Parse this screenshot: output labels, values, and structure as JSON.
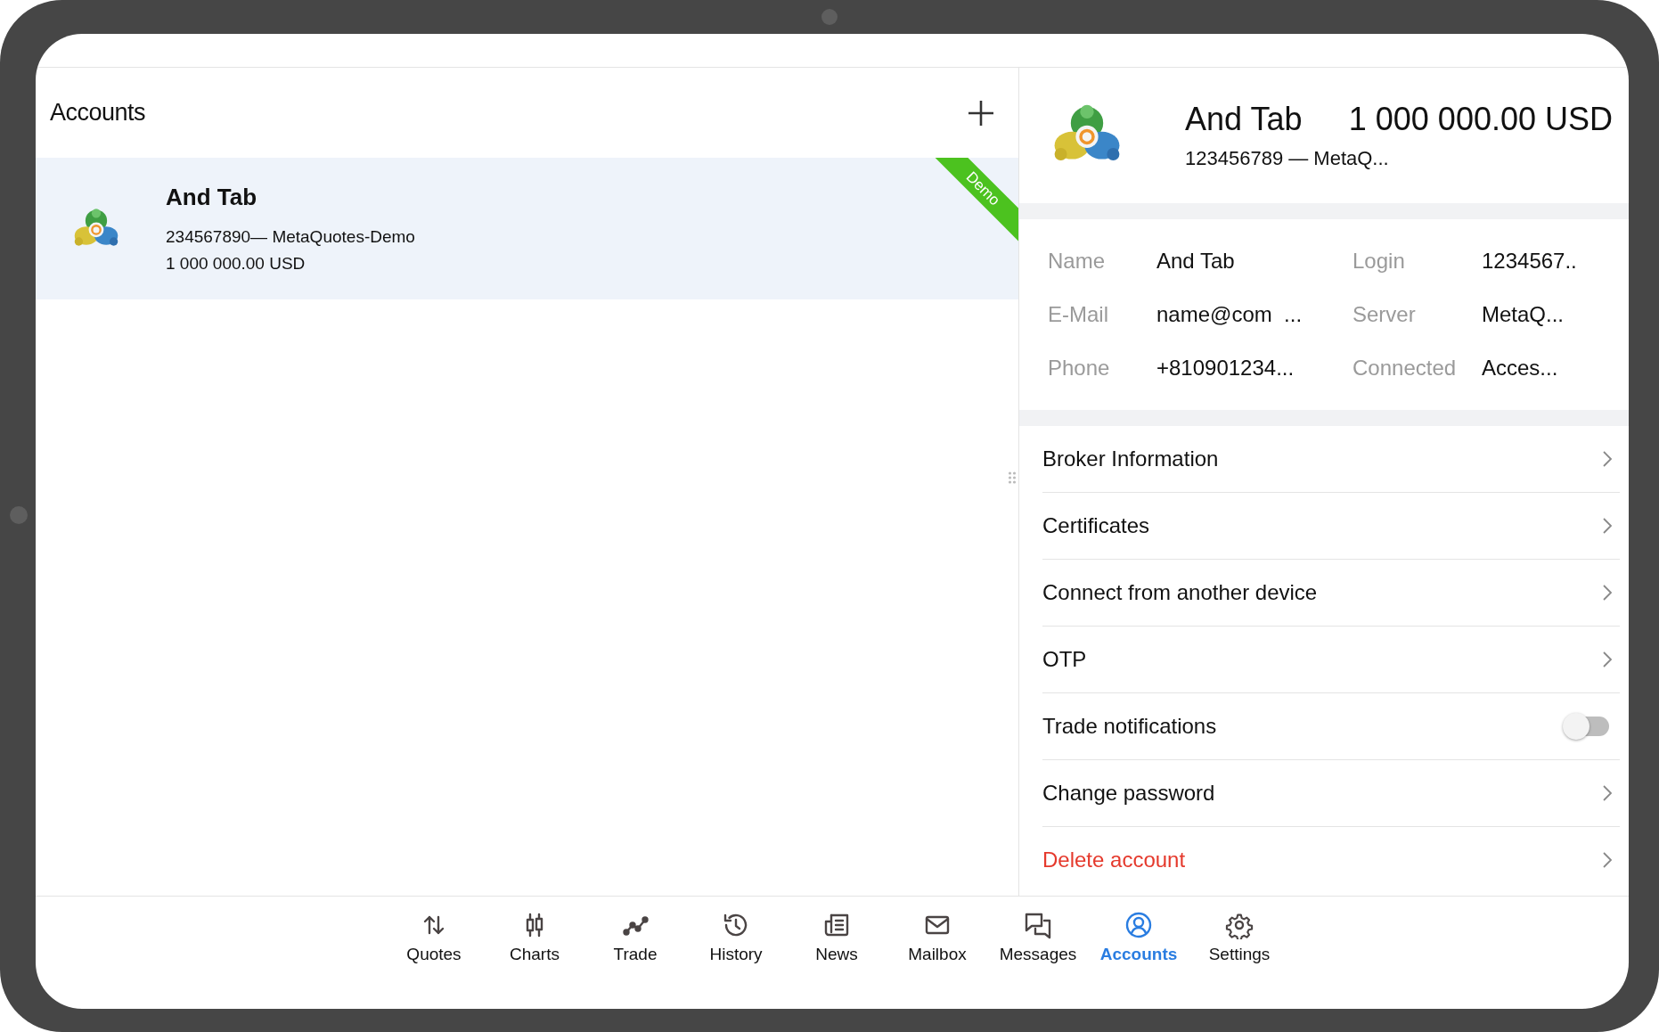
{
  "accounts_panel": {
    "title": "Accounts",
    "accounts": [
      {
        "name": "And Tab",
        "details": "234567890— MetaQuotes-Demo",
        "balance": "1 000 000.00 USD",
        "badge": "Demo",
        "selected": true
      }
    ]
  },
  "account_header": {
    "name": "And Tab",
    "number": "123456789 — MetaQ...",
    "balance": "1 000 000.00 USD"
  },
  "info": [
    {
      "label": "Name",
      "value": "And Tab"
    },
    {
      "label": "Login",
      "value": "1234567.."
    },
    {
      "label": "E-Mail",
      "value": "name@com  ..."
    },
    {
      "label": "Server",
      "value": "MetaQ..."
    },
    {
      "label": "Phone",
      "value": "+810901234..."
    },
    {
      "label": "Connected",
      "value": "Acces..."
    }
  ],
  "menu": [
    {
      "label": "Broker Information",
      "kind": "link"
    },
    {
      "label": "Certificates",
      "kind": "link"
    },
    {
      "label": "Connect from another device",
      "kind": "link"
    },
    {
      "label": "OTP",
      "kind": "link"
    },
    {
      "label": "Trade notifications",
      "kind": "toggle",
      "on": false
    },
    {
      "label": "Change password",
      "kind": "link"
    },
    {
      "label": "Delete account",
      "kind": "danger"
    }
  ],
  "nav": [
    {
      "label": "Quotes",
      "selected": false
    },
    {
      "label": "Charts",
      "selected": false
    },
    {
      "label": "Trade",
      "selected": false
    },
    {
      "label": "History",
      "selected": false
    },
    {
      "label": "News",
      "selected": false
    },
    {
      "label": "Mailbox",
      "selected": false
    },
    {
      "label": "Messages",
      "selected": false
    },
    {
      "label": "Accounts",
      "selected": true
    },
    {
      "label": "Settings",
      "selected": false
    }
  ]
}
